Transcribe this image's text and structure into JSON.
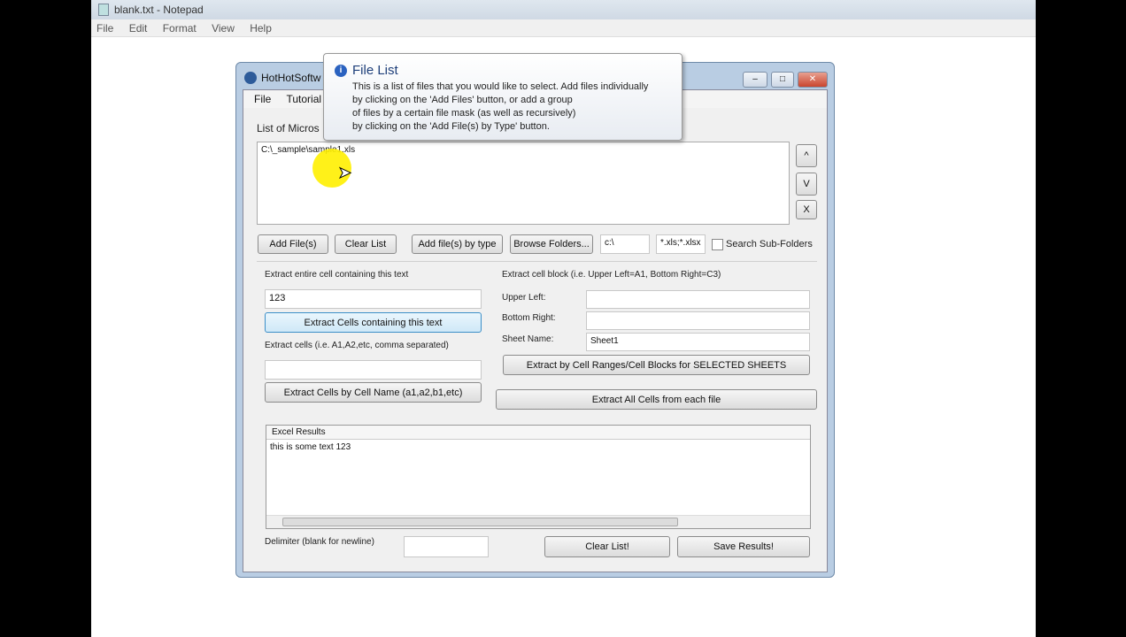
{
  "notepad": {
    "title": "blank.txt - Notepad",
    "menu": [
      "File",
      "Edit",
      "Format",
      "View",
      "Help"
    ]
  },
  "app": {
    "title": "HotHotSoftw",
    "menu": [
      "File",
      "Tutorial"
    ],
    "file_list_label": "List of Micros",
    "files": [
      "C:\\_sample\\sample1.xls"
    ],
    "move_up": "^",
    "move_down": "V",
    "remove": "X",
    "buttons": {
      "add_files": "Add File(s)",
      "clear_list": "Clear List",
      "add_by_type": "Add file(s) by type",
      "browse": "Browse Folders..."
    },
    "folder_value": "c:\\",
    "mask_value": "*.xls;*.xlsx",
    "search_sub": "Search Sub-Folders",
    "extract_text_label": "Extract entire cell containing this text",
    "extract_text_value": "123",
    "extract_text_btn": "Extract Cells containing this text",
    "extract_cells_label": "Extract cells (i.e. A1,A2,etc, comma separated)",
    "extract_cells_value": "",
    "extract_cells_btn": "Extract Cells by Cell Name (a1,a2,b1,etc)",
    "block_label": "Extract cell block (i.e. Upper Left=A1, Bottom Right=C3)",
    "upper_left_label": "Upper Left:",
    "bottom_right_label": "Bottom Right:",
    "sheet_label": "Sheet Name:",
    "sheet_value": "Sheet1",
    "block_btn": "Extract by Cell Ranges/Cell Blocks for SELECTED SHEETS",
    "all_btn": "Extract All Cells from each file",
    "results_header": "Excel Results",
    "results": [
      "this is some text 123"
    ],
    "delimiter_label": "Delimiter (blank for newline)",
    "clear_results": "Clear List!",
    "save_results": "Save Results!"
  },
  "tooltip": {
    "title": "File List",
    "lines": [
      "This is a list of files that you would like to select. Add files individually",
      "by clicking on the 'Add Files' button, or add a group",
      "of files by a certain file mask (as well as recursively)",
      "by clicking on the 'Add File(s) by Type' button."
    ]
  }
}
